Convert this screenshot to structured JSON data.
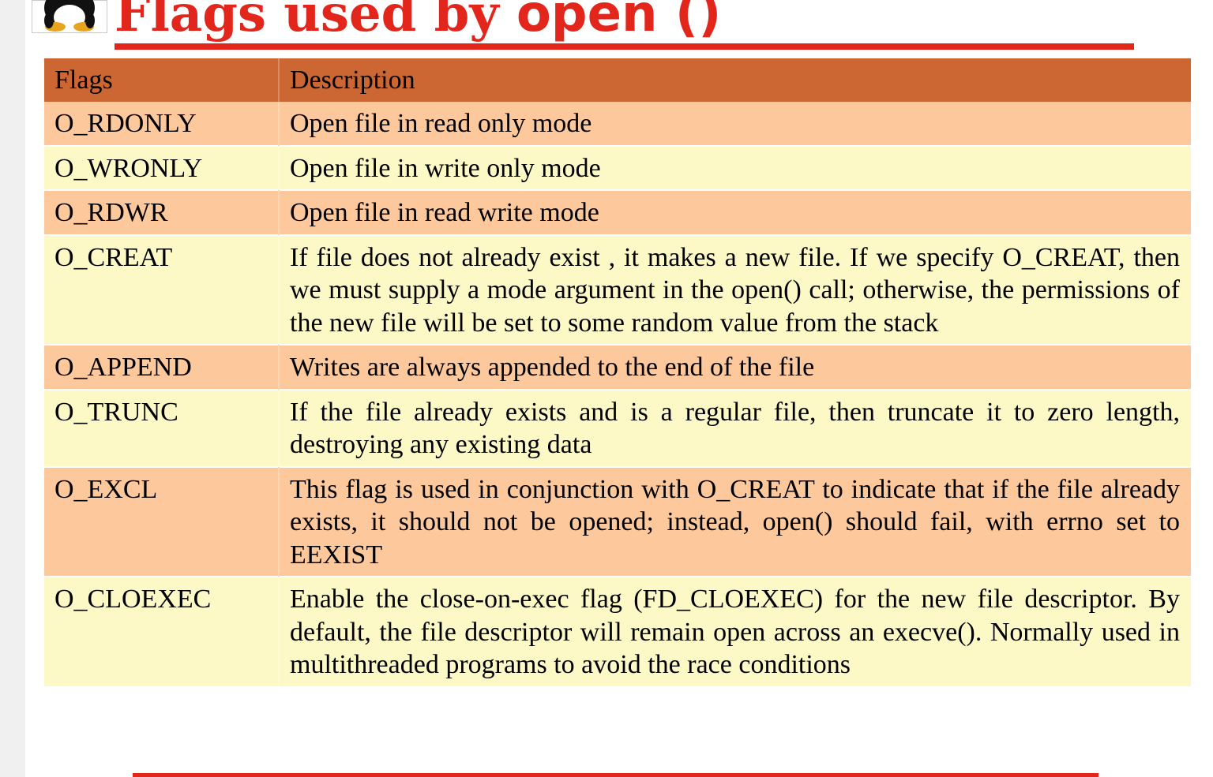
{
  "slide": {
    "title_main": "Flags used by ",
    "title_code": "open ()"
  },
  "table": {
    "headers": {
      "flag": "Flags",
      "description": "Description"
    },
    "rows": [
      {
        "flag": "O_RDONLY",
        "description": "Open file in read only mode"
      },
      {
        "flag": "O_WRONLY",
        "description": "Open file in write only mode"
      },
      {
        "flag": "O_RDWR",
        "description": "Open file in read write mode"
      },
      {
        "flag": "O_CREAT",
        "description": "If file does not already exist , it makes a new file.   If we specify O_CREAT, then we must supply a mode argument in the open() call; otherwise, the permissions of the new file will be set to some random value from the stack"
      },
      {
        "flag": "O_APPEND",
        "description": "Writes are always appended to the end of the file"
      },
      {
        "flag": "O_TRUNC",
        "description": "If the file already exists and is a regular file, then truncate it to zero length, destroying any existing data"
      },
      {
        "flag": "O_EXCL",
        "description": "This flag is used in conjunction with O_CREAT to indicate that if the file already exists, it should not be opened; instead, open() should fail, with errno set to EEXIST"
      },
      {
        "flag": "O_CLOEXEC",
        "description": "Enable the close-on-exec flag (FD_CLOEXEC) for the new file descriptor. By default,  the file descriptor will remain open across an execve(). Normally used in multithreaded programs to avoid the race conditions"
      }
    ]
  },
  "colors": {
    "title": "#e3261b",
    "header_bg": "#cc6633",
    "row_odd_bg": "#fdc89b",
    "row_even_bg": "#fcf9c6"
  },
  "icons": {
    "logo": "tux-penguin-icon"
  }
}
